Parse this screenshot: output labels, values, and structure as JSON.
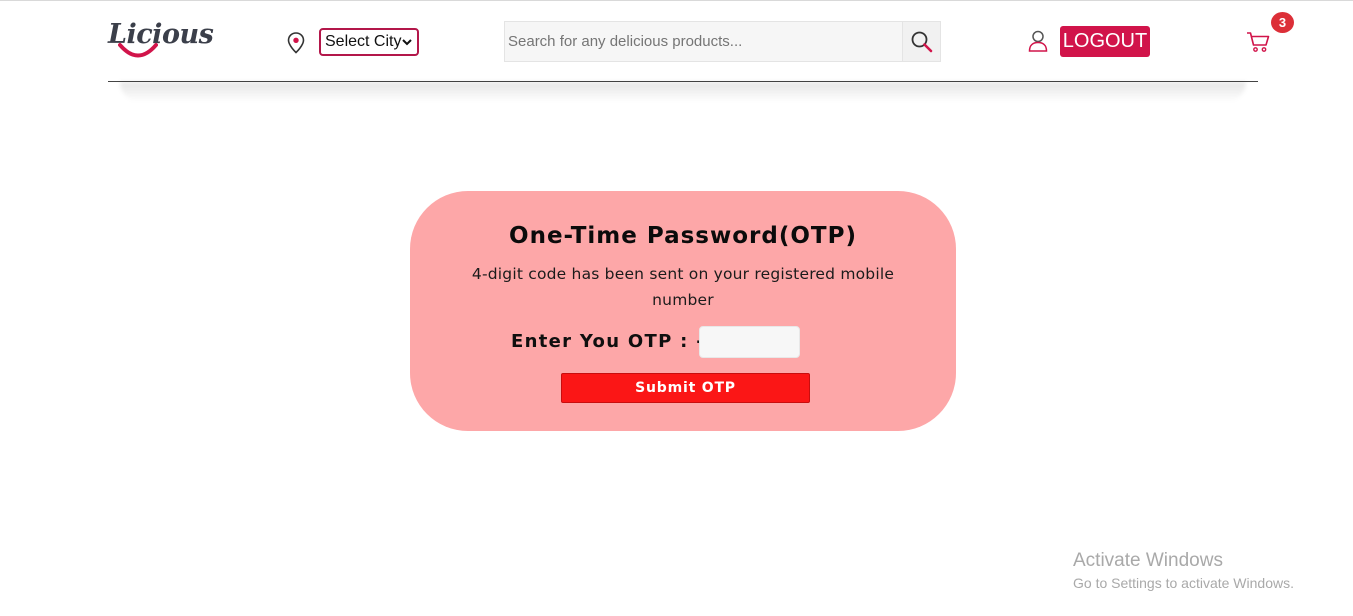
{
  "header": {
    "logo_text": "Licious",
    "city_select": {
      "value": "Select City"
    },
    "search": {
      "placeholder": "Search for any delicious products..."
    },
    "logout_label": "LOGOUT",
    "cart_count": "3"
  },
  "otp": {
    "title": "One-Time Password(OTP)",
    "subtitle": "4-digit code has been sent on your registered mobile number",
    "label": "Enter You OTP : -",
    "input_value": "",
    "submit_label": "Submit OTP"
  },
  "watermark": {
    "title": "Activate Windows",
    "subtitle": "Go to Settings to activate Windows."
  },
  "colors": {
    "brand": "#d1144a",
    "card_bg": "#fda7a8",
    "submit_bg": "#fb1616",
    "badge": "#dc2f38"
  }
}
